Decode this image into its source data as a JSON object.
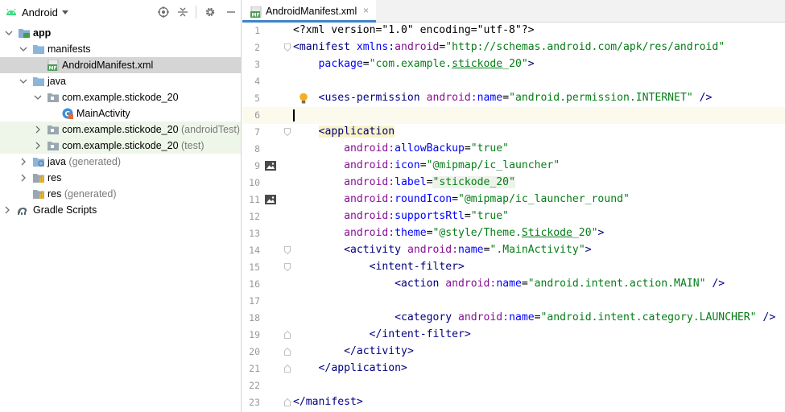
{
  "project_panel": {
    "title": "Android",
    "tree": [
      {
        "label": "app",
        "bold": true
      },
      {
        "label": "manifests"
      },
      {
        "label": "AndroidManifest.xml"
      },
      {
        "label": "java"
      },
      {
        "label": "com.example.stickode_20"
      },
      {
        "label": "MainActivity"
      },
      {
        "label": "com.example.stickode_20",
        "suffix": "(androidTest)"
      },
      {
        "label": "com.example.stickode_20",
        "suffix": "(test)"
      },
      {
        "label": "java",
        "suffix": "(generated)"
      },
      {
        "label": "res"
      },
      {
        "label": "res",
        "suffix": "(generated)"
      },
      {
        "label": "Gradle Scripts"
      }
    ]
  },
  "editor": {
    "tab_label": "AndroidManifest.xml",
    "tab_close": "×",
    "line_numbers": [
      "1",
      "2",
      "3",
      "4",
      "5",
      "6",
      "7",
      "8",
      "9",
      "10",
      "11",
      "12",
      "13",
      "14",
      "15",
      "16",
      "17",
      "18",
      "19",
      "20",
      "21",
      "22",
      "23"
    ],
    "lines": {
      "l1_pi": "<?xml version=\"1.0\" encoding=\"utf-8\"?>",
      "l2_open": "<",
      "l2_tag": "manifest",
      "l2_ns": "xmlns:",
      "l2_attr": "android",
      "l2_eq": "=",
      "l2_val": "\"http://schemas.android.com/apk/res/android\"",
      "l3_attr": "package",
      "l3_eq": "=",
      "l3_val_a": "\"com.example.",
      "l3_val_b": "stickode",
      "l3_val_c": "_20\"",
      "l3_close": ">",
      "l5_open": "<",
      "l5_tag": "uses-permission",
      "l5_ns": "android:",
      "l5_attr": "name",
      "l5_eq": "=",
      "l5_val": "\"android.permission.INTERNET\"",
      "l5_close": " />",
      "l7_open": "<",
      "l7_tag": "application",
      "l8_ns": "android:",
      "l8_attr": "allowBackup",
      "l8_eq": "=",
      "l8_val": "\"true\"",
      "l9_ns": "android:",
      "l9_attr": "icon",
      "l9_eq": "=",
      "l9_val": "\"@mipmap/ic_launcher\"",
      "l10_ns": "android:",
      "l10_attr": "label",
      "l10_eq": "=",
      "l10_val": "\"stickode_20\"",
      "l11_ns": "android:",
      "l11_attr": "roundIcon",
      "l11_eq": "=",
      "l11_val": "\"@mipmap/ic_launcher_round\"",
      "l12_ns": "android:",
      "l12_attr": "supportsRtl",
      "l12_eq": "=",
      "l12_val": "\"true\"",
      "l13_ns": "android:",
      "l13_attr": "theme",
      "l13_eq": "=",
      "l13_val_a": "\"@style/Theme.",
      "l13_val_b": "Stickode",
      "l13_val_c": "_20\"",
      "l13_close": ">",
      "l14_open": "<",
      "l14_tag": "activity",
      "l14_ns": "android:",
      "l14_attr": "name",
      "l14_eq": "=",
      "l14_val": "\".MainActivity\"",
      "l14_close": ">",
      "l15_open": "<",
      "l15_tag": "intent-filter",
      "l15_close": ">",
      "l16_open": "<",
      "l16_tag": "action",
      "l16_ns": "android:",
      "l16_attr": "name",
      "l16_eq": "=",
      "l16_val": "\"android.intent.action.MAIN\"",
      "l16_close": " />",
      "l18_open": "<",
      "l18_tag": "category",
      "l18_ns": "android:",
      "l18_attr": "name",
      "l18_eq": "=",
      "l18_val": "\"android.intent.category.LAUNCHER\"",
      "l18_close": " />",
      "l19_open": "</",
      "l19_tag": "intent-filter",
      "l19_close": ">",
      "l20_open": "</",
      "l20_tag": "activity",
      "l20_close": ">",
      "l21_open": "</",
      "l21_tag": "application",
      "l21_close": ">",
      "l23_open": "</",
      "l23_tag": "manifest",
      "l23_close": ">"
    }
  },
  "colors": {
    "tag": "#000080",
    "attribute": "#0000ff",
    "namespace": "#871094",
    "value": "#067d17",
    "selection": "#d5d5d5",
    "test_row": "#eef6ea",
    "tab_underline": "#4083c9"
  },
  "icons": [
    "android-icon",
    "target-icon",
    "collapse-icon",
    "gear-icon",
    "minimize-icon",
    "manifest-file-icon",
    "folder-icon",
    "package-icon",
    "class-icon",
    "chevron-icon",
    "bulb-icon",
    "image-icon",
    "fold-icon",
    "gradle-icon"
  ]
}
